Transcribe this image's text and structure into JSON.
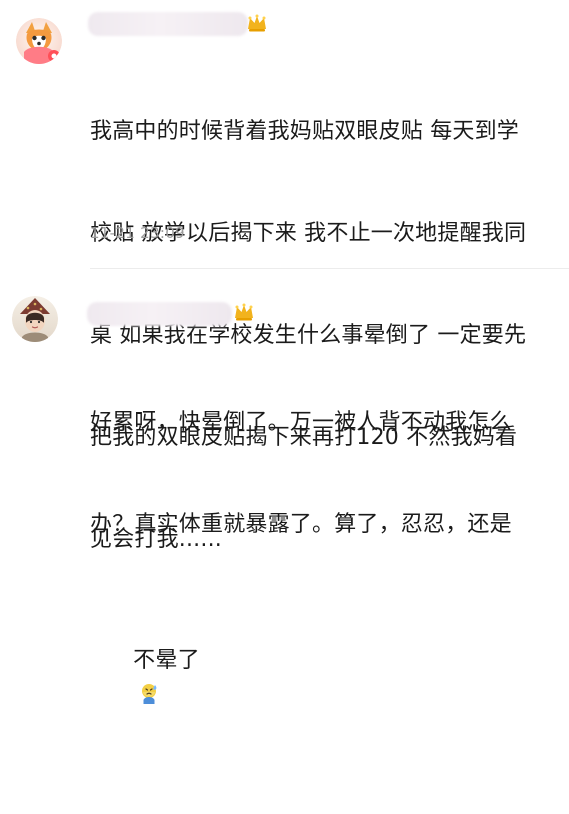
{
  "comments": [
    {
      "text_lines": [
        "我高中的时候背着我妈贴双眼皮贴 每天到学",
        "校贴 放学以后揭下来 我不止一次地提醒我同",
        "桌 如果我在学校发生什么事晕倒了 一定要先",
        "把我的双眼皮贴揭下来再打120 不然我妈看",
        "见会打我......"
      ],
      "timestamp": "11-21 23:09",
      "avatar_icon": "fox-cartoon-avatar",
      "badge_icon": "crown-icon"
    },
    {
      "text_lines": [
        "好累呀，快晕倒了。万一被人背不动我怎么",
        "办？真实体重就暴露了。算了，忍忍，还是",
        "不晕了"
      ],
      "avatar_icon": "child-with-hat-avatar",
      "badge_icon": "crown-icon",
      "emoji_icon": "sweat-emoji-icon"
    }
  ],
  "colors": {
    "text": "#1b1b1b",
    "timestamp": "#9b9b9b",
    "crown": "#f2b31d",
    "divider": "#ececec"
  }
}
